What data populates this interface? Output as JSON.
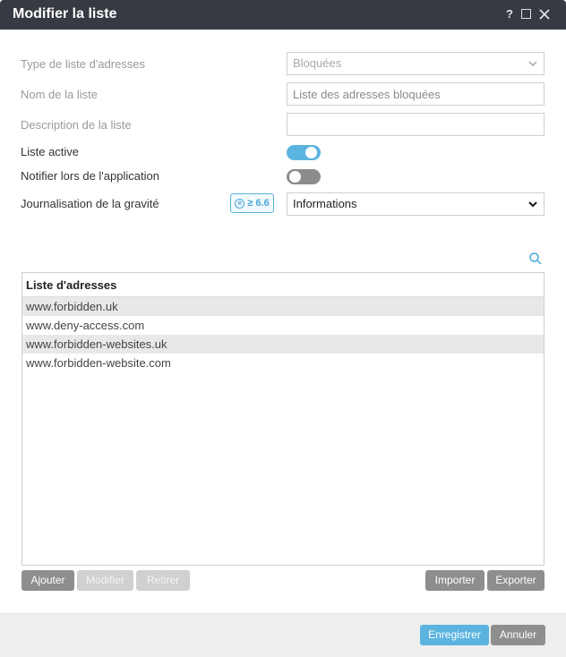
{
  "window": {
    "title": "Modifier la liste",
    "help_icon": "?",
    "icons": [
      "help-icon",
      "maximize-icon",
      "close-icon"
    ]
  },
  "form": {
    "type_label": "Type de liste d'adresses",
    "type_value": "Bloquées",
    "name_label": "Nom de la liste",
    "name_value": "Liste des adresses bloquées",
    "description_label": "Description de la liste",
    "description_value": "",
    "active_label": "Liste active",
    "active_on": true,
    "notify_label": "Notifier lors de l'application",
    "notify_on": false,
    "severity_label": "Journalisation de la gravité",
    "severity_badge": "≥ 6.6",
    "severity_badge_icon": "e",
    "severity_value": "Informations"
  },
  "list": {
    "search_icon": "search-icon",
    "header": "Liste d'adresses",
    "rows": [
      "www.forbidden.uk",
      "www.deny-access.com",
      "www.forbidden-websites.uk",
      "www.forbidden-website.com"
    ]
  },
  "list_buttons": {
    "add": "Ajouter",
    "edit": "Modifier",
    "remove": "Retirer",
    "import": "Importer",
    "export": "Exporter"
  },
  "footer": {
    "save": "Enregistrer",
    "cancel": "Annuler"
  },
  "colors": {
    "accent": "#5bb4e0",
    "titlebar": "#373a42",
    "button_gray": "#8e8e8e",
    "button_disabled": "#d0d0d0"
  }
}
